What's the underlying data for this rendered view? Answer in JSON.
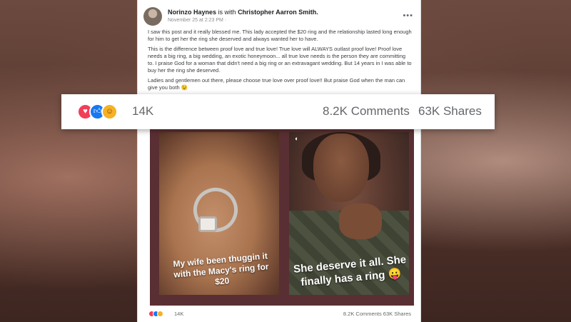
{
  "post": {
    "author": "Norinzo Haynes",
    "with_text": "is with",
    "tagged": "Christopher Aarron Smith.",
    "date": "November 25 at 2:23 PM ·",
    "paragraphs": [
      "I saw this post and it really blessed me. This lady accepted the $20 ring and the relationship lasted long enough for him to get her the ring she deserved and always wanted her to have.",
      "This is the difference between proof love and true love! True love will ALWAYS outlast proof love! Proof love needs a big ring, a big wedding, an exotic honeymoon... all true love needs is the person they are committing to. I praise God for a woman that didn't need a big ring or an extravagant wedding. But 14 years in I was able to buy her the ring she deserved.",
      "Ladies and gentlemen out there, please choose true love over proof love!! But praise God when the man can give you both 😉"
    ],
    "photo_captions": [
      "My wife been thuggin it with the Macy's ring for $20",
      "She deserve it all. She finally has a ring 😛"
    ],
    "footer": {
      "reactions_count": "14K",
      "comments": "8.2K Comments",
      "shares": "63K Shares"
    }
  },
  "stats_bar": {
    "reaction_icons": [
      "love-icon",
      "like-icon",
      "care-icon"
    ],
    "reactions_count": "14K",
    "comments": "8.2K Comments",
    "shares": "63K Shares"
  },
  "colors": {
    "love": "#f33e58",
    "like": "#1877f2",
    "care": "#f7b125",
    "meta_text": "#65676b"
  }
}
